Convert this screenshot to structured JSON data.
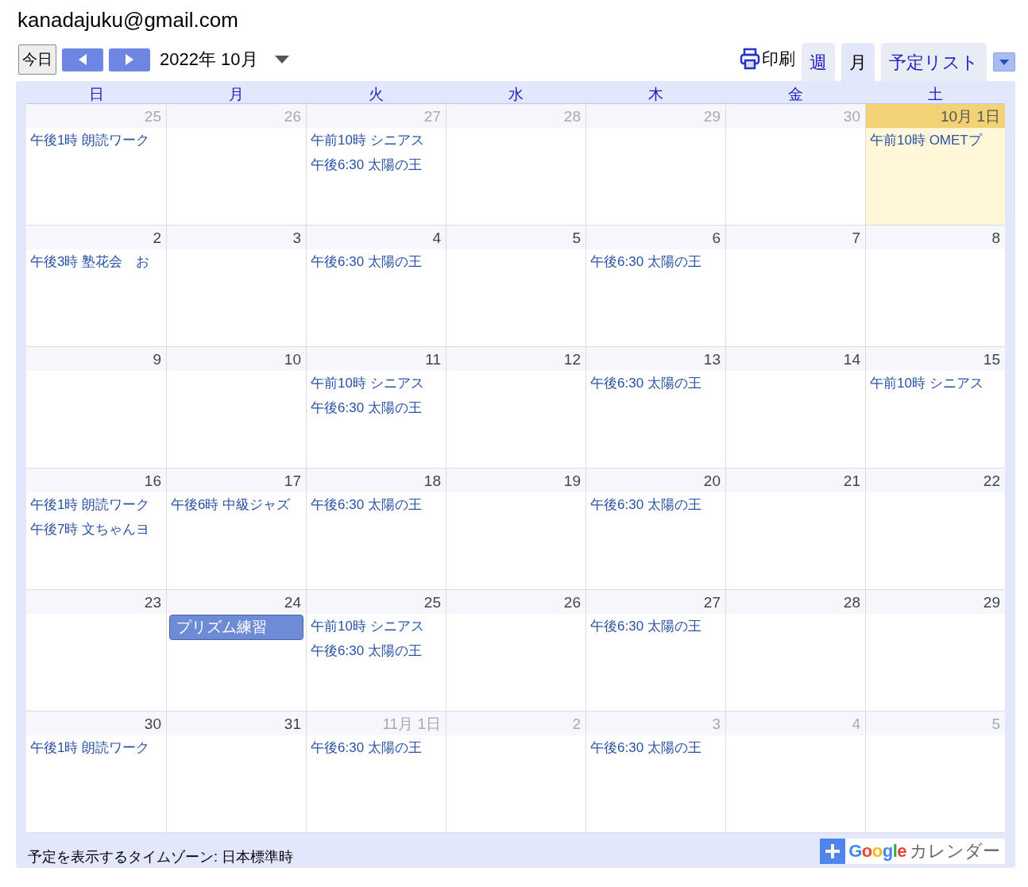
{
  "account": "kanadajuku@gmail.com",
  "toolbar": {
    "today_button": "今日",
    "period": "2022年 10月",
    "print": "印刷",
    "tabs": [
      {
        "label": "週",
        "selected": false
      },
      {
        "label": "月",
        "selected": true
      },
      {
        "label": "予定リスト",
        "selected": false
      }
    ]
  },
  "weekdays": [
    "日",
    "月",
    "火",
    "水",
    "木",
    "金",
    "土"
  ],
  "weeks": [
    {
      "days": [
        {
          "date": "25",
          "outside_month": true,
          "today": false,
          "events": [
            {
              "kind": "text",
              "text": "午後1時 朗読ワーク"
            }
          ]
        },
        {
          "date": "26",
          "outside_month": true,
          "today": false
        },
        {
          "date": "27",
          "outside_month": true,
          "today": false,
          "events": [
            {
              "kind": "text",
              "text": "午前10時 シニアス"
            },
            {
              "kind": "text",
              "text": "午後6:30 太陽の王"
            }
          ]
        },
        {
          "date": "28",
          "outside_month": true,
          "today": false
        },
        {
          "date": "29",
          "outside_month": true,
          "today": false
        },
        {
          "date": "30",
          "outside_month": true,
          "today": false
        },
        {
          "date": "10月 1日",
          "outside_month": false,
          "today": true,
          "events": [
            {
              "kind": "text",
              "text": "午前10時 OMETプ"
            }
          ]
        }
      ]
    },
    {
      "days": [
        {
          "date": "2",
          "outside_month": false,
          "today": false,
          "events": [
            {
              "kind": "text",
              "text": "午後3時 塾花会　お"
            }
          ]
        },
        {
          "date": "3",
          "outside_month": false,
          "today": false
        },
        {
          "date": "4",
          "outside_month": false,
          "today": false,
          "events": [
            {
              "kind": "text",
              "text": "午後6:30 太陽の王"
            }
          ]
        },
        {
          "date": "5",
          "outside_month": false,
          "today": false
        },
        {
          "date": "6",
          "outside_month": false,
          "today": false,
          "events": [
            {
              "kind": "text",
              "text": "午後6:30 太陽の王"
            }
          ]
        },
        {
          "date": "7",
          "outside_month": false,
          "today": false
        },
        {
          "date": "8",
          "outside_month": false,
          "today": false
        }
      ]
    },
    {
      "days": [
        {
          "date": "9",
          "outside_month": false,
          "today": false
        },
        {
          "date": "10",
          "outside_month": false,
          "today": false
        },
        {
          "date": "11",
          "outside_month": false,
          "today": false,
          "events": [
            {
              "kind": "text",
              "text": "午前10時 シニアス"
            },
            {
              "kind": "text",
              "text": "午後6:30 太陽の王"
            }
          ]
        },
        {
          "date": "12",
          "outside_month": false,
          "today": false
        },
        {
          "date": "13",
          "outside_month": false,
          "today": false,
          "events": [
            {
              "kind": "text",
              "text": "午後6:30 太陽の王"
            }
          ]
        },
        {
          "date": "14",
          "outside_month": false,
          "today": false
        },
        {
          "date": "15",
          "outside_month": false,
          "today": false,
          "events": [
            {
              "kind": "text",
              "text": "午前10時 シニアス"
            }
          ]
        }
      ]
    },
    {
      "days": [
        {
          "date": "16",
          "outside_month": false,
          "today": false,
          "events": [
            {
              "kind": "text",
              "text": "午後1時 朗読ワーク"
            },
            {
              "kind": "text",
              "text": "午後7時 文ちゃんヨ"
            }
          ]
        },
        {
          "date": "17",
          "outside_month": false,
          "today": false,
          "events": [
            {
              "kind": "text",
              "text": "午後6時 中級ジャズ"
            }
          ]
        },
        {
          "date": "18",
          "outside_month": false,
          "today": false,
          "events": [
            {
              "kind": "text",
              "text": "午後6:30 太陽の王"
            }
          ]
        },
        {
          "date": "19",
          "outside_month": false,
          "today": false
        },
        {
          "date": "20",
          "outside_month": false,
          "today": false,
          "events": [
            {
              "kind": "text",
              "text": "午後6:30 太陽の王"
            }
          ]
        },
        {
          "date": "21",
          "outside_month": false,
          "today": false
        },
        {
          "date": "22",
          "outside_month": false,
          "today": false
        }
      ]
    },
    {
      "days": [
        {
          "date": "23",
          "outside_month": false,
          "today": false
        },
        {
          "date": "24",
          "outside_month": false,
          "today": false,
          "events": [
            {
              "kind": "chip",
              "text": "プリズム練習"
            }
          ]
        },
        {
          "date": "25",
          "outside_month": false,
          "today": false,
          "events": [
            {
              "kind": "text",
              "text": "午前10時 シニアス"
            },
            {
              "kind": "text",
              "text": "午後6:30 太陽の王"
            }
          ]
        },
        {
          "date": "26",
          "outside_month": false,
          "today": false
        },
        {
          "date": "27",
          "outside_month": false,
          "today": false,
          "events": [
            {
              "kind": "text",
              "text": "午後6:30 太陽の王"
            }
          ]
        },
        {
          "date": "28",
          "outside_month": false,
          "today": false
        },
        {
          "date": "29",
          "outside_month": false,
          "today": false
        }
      ]
    },
    {
      "days": [
        {
          "date": "30",
          "outside_month": false,
          "today": false,
          "events": [
            {
              "kind": "text",
              "text": "午後1時 朗読ワーク"
            }
          ]
        },
        {
          "date": "31",
          "outside_month": false,
          "today": false
        },
        {
          "date": "11月 1日",
          "outside_month": true,
          "today": false,
          "events": [
            {
              "kind": "text",
              "text": "午後6:30 太陽の王"
            }
          ]
        },
        {
          "date": "2",
          "outside_month": true,
          "today": false
        },
        {
          "date": "3",
          "outside_month": true,
          "today": false,
          "events": [
            {
              "kind": "text",
              "text": "午後6:30 太陽の王"
            }
          ]
        },
        {
          "date": "4",
          "outside_month": true,
          "today": false
        },
        {
          "date": "5",
          "outside_month": true,
          "today": false
        }
      ]
    }
  ],
  "footer": {
    "timezone": "予定を表示するタイムゾーン: 日本標準時",
    "badge_logo": "Google",
    "badge_label": "カレンダー"
  }
}
